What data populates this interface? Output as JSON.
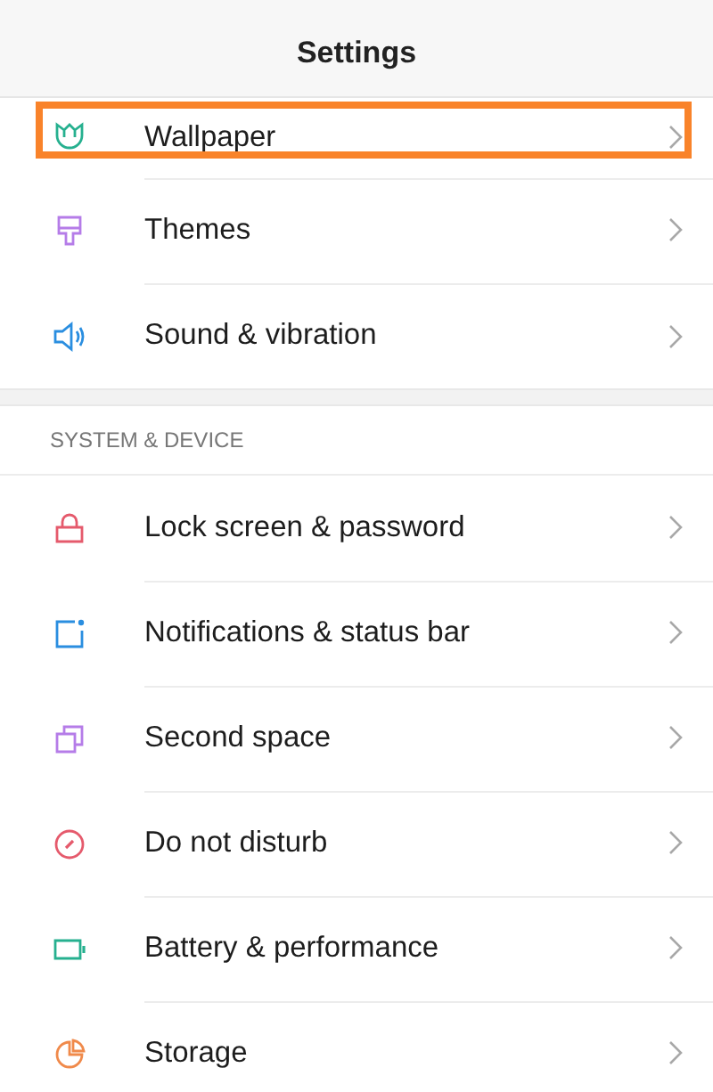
{
  "header": {
    "title": "Settings"
  },
  "sections": [
    {
      "items": [
        {
          "label": "Wallpaper",
          "highlighted": true
        },
        {
          "label": "Themes",
          "highlighted": false
        },
        {
          "label": "Sound & vibration",
          "highlighted": false
        }
      ]
    },
    {
      "heading": "SYSTEM & DEVICE",
      "items": [
        {
          "label": "Lock screen & password",
          "highlighted": false
        },
        {
          "label": "Notifications & status bar",
          "highlighted": false
        },
        {
          "label": "Second space",
          "highlighted": false
        },
        {
          "label": "Do not disturb",
          "highlighted": false
        },
        {
          "label": "Battery & performance",
          "highlighted": false
        },
        {
          "label": "Storage",
          "highlighted": false
        }
      ]
    }
  ]
}
